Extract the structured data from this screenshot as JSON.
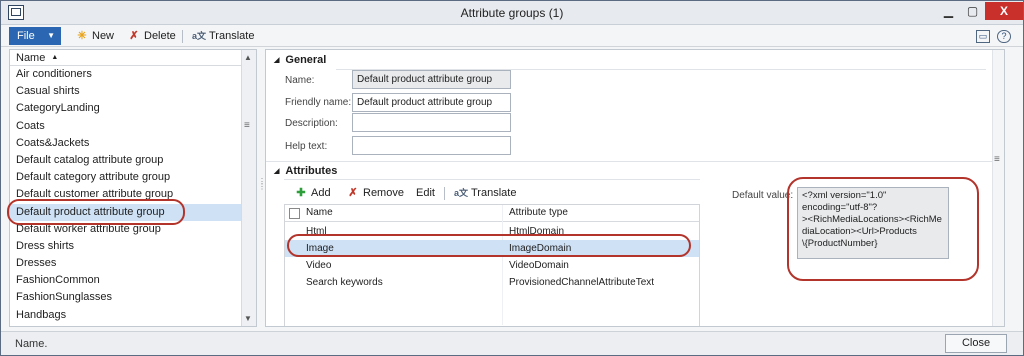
{
  "window": {
    "title": "Attribute groups (1)",
    "min_icon": "minimize-icon",
    "max_icon": "maximize-icon",
    "close_glyph": "X"
  },
  "toolbar": {
    "file_label": "File",
    "new_label": "New",
    "delete_label": "Delete",
    "translate_label": "Translate"
  },
  "list": {
    "header": "Name",
    "items": [
      "Air conditioners",
      "Casual shirts",
      "CategoryLanding",
      "Coats",
      "Coats&Jackets",
      "Default catalog attribute group",
      "Default category attribute group",
      "Default customer attribute group",
      "Default product attribute group",
      "Default worker attribute group",
      "Dress shirts",
      "Dresses",
      "FashionCommon",
      "FashionSunglasses",
      "Handbags"
    ],
    "selected_index": 8
  },
  "general": {
    "title": "General",
    "name_label": "Name:",
    "name_value": "Default product attribute group",
    "friendly_label": "Friendly name:",
    "friendly_value": "Default product attribute group",
    "description_label": "Description:",
    "description_value": "",
    "help_label": "Help text:",
    "help_value": ""
  },
  "attributes": {
    "title": "Attributes",
    "add_label": "Add",
    "remove_label": "Remove",
    "edit_label": "Edit",
    "translate_label": "Translate",
    "col_name": "Name",
    "col_type": "Attribute type",
    "rows": [
      {
        "name": "Html",
        "type": "HtmlDomain"
      },
      {
        "name": "Image",
        "type": "ImageDomain"
      },
      {
        "name": "Video",
        "type": "VideoDomain"
      },
      {
        "name": "Search keywords",
        "type": "ProvisionedChannelAttributeText"
      }
    ],
    "selected_index": 1,
    "default_value_label": "Default value:",
    "default_value": "<?xml version=\"1.0\"\nencoding=\"utf-8\"?\n><RichMediaLocations><RichMe\ndiaLocation><Url>Products\n\\{ProductNumber}"
  },
  "status": {
    "text": "Name.",
    "close_label": "Close"
  },
  "colors": {
    "accent": "#2a66b1",
    "selection": "#cfe1f5",
    "highlight": "#b3342b"
  }
}
